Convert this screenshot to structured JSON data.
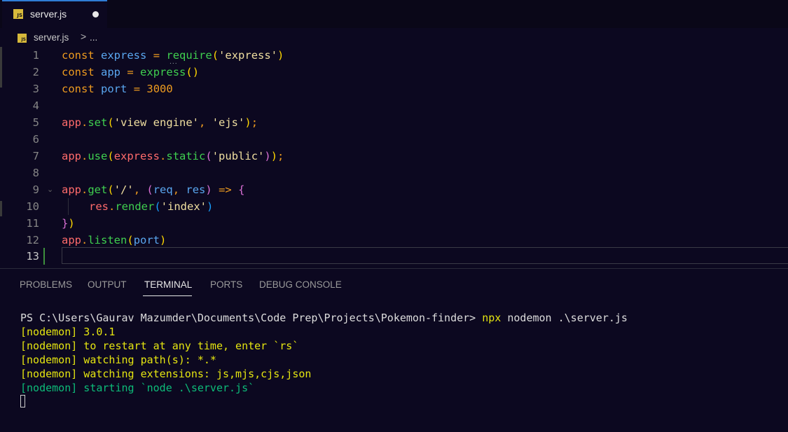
{
  "tab": {
    "icon": "js-file-icon",
    "badge": "JS",
    "label": "server.js"
  },
  "breadcrumb": {
    "badge": "JS",
    "file": "server.js",
    "separator": ">",
    "more": "..."
  },
  "editor": {
    "line_numbers": [
      "1",
      "2",
      "3",
      "4",
      "5",
      "6",
      "7",
      "8",
      "9",
      "10",
      "11",
      "12",
      "13"
    ],
    "hint": "...",
    "fold_icon": "chevron-down-icon",
    "tokens": {
      "l1": [
        "const",
        "express",
        "=",
        "require",
        "(",
        "'express'",
        ")"
      ],
      "l2": [
        "const",
        "app",
        "=",
        "express",
        "(",
        ")"
      ],
      "l3": [
        "const",
        "port",
        "=",
        "3000"
      ],
      "l5": [
        "app",
        ".",
        "set",
        "(",
        "'view engine'",
        ", ",
        "'ejs'",
        ")",
        ";"
      ],
      "l7": [
        "app",
        ".",
        "use",
        "(",
        "express",
        ".",
        "static",
        "(",
        "'public'",
        ")",
        ")",
        ";"
      ],
      "l9": [
        "app",
        ".",
        "get",
        "(",
        "'/'",
        ", ",
        "(",
        "req",
        ", ",
        "res",
        ")",
        "=>",
        "{"
      ],
      "l10": [
        "res",
        ".",
        "render",
        "(",
        "'index'",
        ")"
      ],
      "l11": [
        "}",
        ")"
      ],
      "l12": [
        "app",
        ".",
        "listen",
        "(",
        "port",
        ")"
      ]
    }
  },
  "panel": {
    "tabs": [
      "PROBLEMS",
      "OUTPUT",
      "TERMINAL",
      "PORTS",
      "DEBUG CONSOLE"
    ],
    "active_tab": "TERMINAL"
  },
  "terminal": {
    "prompt": "PS C:\\Users\\Gaurav Mazumder\\Documents\\Code Prep\\Projects\\Pokemon-finder>",
    "cmd_npx": "npx",
    "cmd_rest": "nodemon .\\server.js",
    "lines": [
      "[nodemon] 3.0.1",
      "[nodemon] to restart at any time, enter `rs`",
      "[nodemon] watching path(s): *.*",
      "[nodemon] watching extensions: js,mjs,cjs,json",
      "[nodemon] starting `node .\\server.js`"
    ]
  },
  "colors": {
    "background": "#0c0820",
    "keyword": "#ee9b1f",
    "variable": "#5aa7f0",
    "function": "#3fcf4f",
    "string": "#f0dfa0",
    "terminal_yellow": "#e5e510",
    "terminal_green": "#0dbc79",
    "tab_active_border": "#2f7dd6"
  }
}
